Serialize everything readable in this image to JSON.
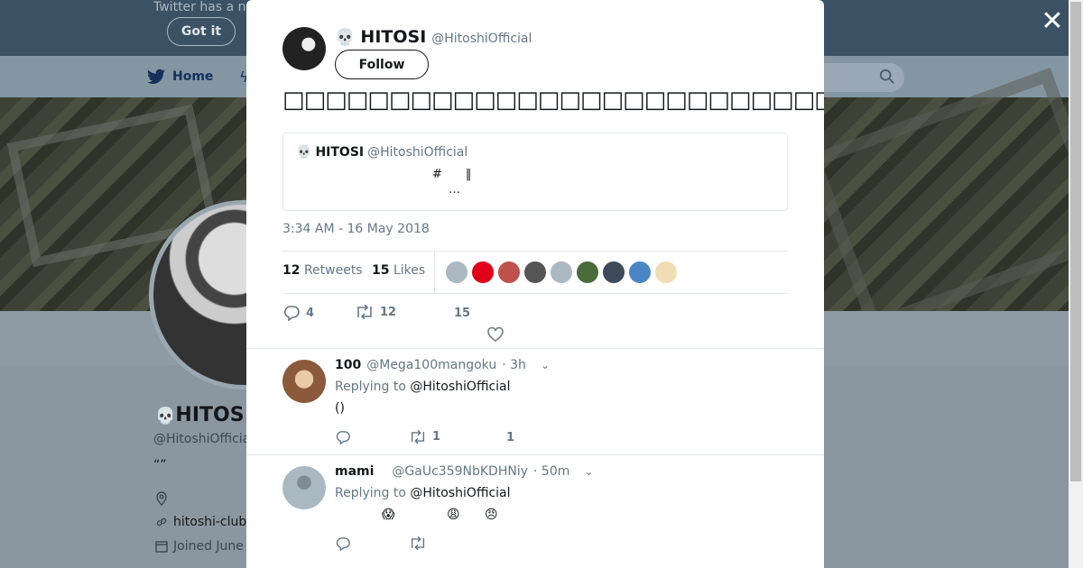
{
  "background": {
    "notice_text": "Twitter has a n",
    "got_it_label": "Got it",
    "nav_home_label": "Home",
    "profile_name": "HITOS",
    "profile_handle": "@HitoshiOfficia",
    "profile_quote": "“”",
    "profile_link": "hitoshi-club",
    "profile_joined": "Joined June"
  },
  "modal": {
    "author": {
      "name": "HITOSI",
      "handle": "@HitoshiOfficial",
      "skull": "💀"
    },
    "follow_label": "Follow",
    "tweet_text": "□□□□□□□□□□□□□□□□□□□□□□□□□□□□□□□□□□□□□□□□",
    "tweet_bang": "‼",
    "quote": {
      "skull": "💀",
      "name": "HITOSI",
      "handle": "@HitoshiOfficial",
      "line1": "#　　‖",
      "line2": "…"
    },
    "timestamp": "3:34 AM - 16 May 2018",
    "stats": {
      "retweets_count": "12",
      "retweets_label": "Retweets",
      "likes_count": "15",
      "likes_label": "Likes"
    },
    "likers_colors": [
      "#aab8c2",
      "#e0001a",
      "#c0504d",
      "#555555",
      "#aab8c2",
      "#4a6b3a",
      "#3c4a5a",
      "#4a86c5",
      "#f2dcb3"
    ],
    "actions": {
      "replies": "4",
      "retweets": "12",
      "likes": "15"
    },
    "replies": [
      {
        "name": "100",
        "handle": "@Mega100mangoku",
        "time": "· 3h",
        "replying_prefix": "Replying to",
        "replying_to": "@HitoshiOfficial",
        "text": "()",
        "retweets": "1",
        "likes": "1",
        "avatar_color": "#8a5a3a"
      },
      {
        "name": "mami",
        "handle": "@GaUc359NbKDHNiy",
        "time": "· 50m",
        "replying_prefix": "Replying to",
        "replying_to": "@HitoshiOfficial",
        "emoji1": "😱",
        "emoji2": "😩",
        "emoji3": "😠",
        "avatar_color": "#aab8c2"
      }
    ]
  },
  "close_label": "✕"
}
